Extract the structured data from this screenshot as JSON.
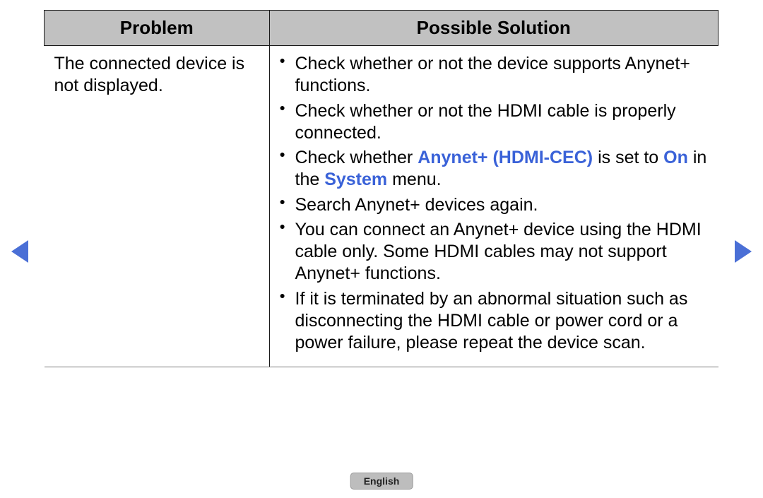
{
  "table": {
    "headers": {
      "problem": "Problem",
      "solution": "Possible Solution"
    },
    "row": {
      "problem": "The connected device is not displayed.",
      "solutions": {
        "s0": "Check whether or not the device supports Anynet+ functions.",
        "s1": "Check whether or not the HDMI cable is properly connected.",
        "s2": {
          "pre": "Check whether ",
          "hl1": "Anynet+ (HDMI-CEC)",
          "mid1": " is set to ",
          "hl2": "On",
          "mid2": " in the ",
          "hl3": "System",
          "post": " menu."
        },
        "s3": "Search Anynet+ devices again.",
        "s4": "You can connect an Anynet+ device using the HDMI cable only. Some HDMI cables may not support Anynet+ functions.",
        "s5": "If it is terminated by an abnormal situation such as disconnecting the HDMI cable or power cord or a power failure, please repeat the device scan."
      }
    }
  },
  "footer": {
    "language": "English"
  }
}
